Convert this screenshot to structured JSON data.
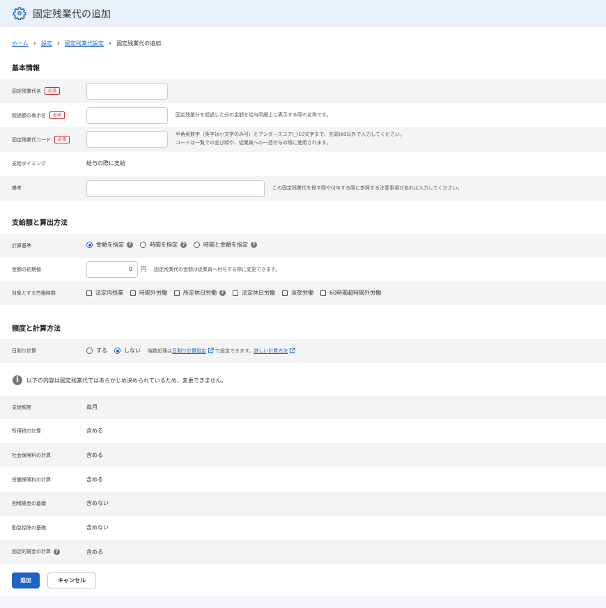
{
  "header": {
    "title": "固定残業代の追加",
    "icon": "gear-icon"
  },
  "breadcrumb": {
    "items": [
      "ホーム",
      "設定",
      "固定残業代設定"
    ],
    "current": "固定残業代の追加"
  },
  "sections": {
    "basic": "基本情報",
    "payment": "支給額と算出方法",
    "frequency": "頻度と計算方法"
  },
  "basic": {
    "name_label": "固定残業代名",
    "required": "必須",
    "display_name_label": "超過額の表示名",
    "display_name_help": "固定残業分を超過した分の金額を給与明細上に表示する際の名称です。",
    "code_label": "固定残業代コード",
    "code_help_1": "半角英数字（英字は小文字のみ可）とアンダースコア(_)10文字まで、先頭は0以外で入力してください。",
    "code_help_2": "コードは一覧での並び順や、従業員への一括付与の際に使用されます。",
    "timing_label": "支給タイミング",
    "timing_value": "給与の際に支給",
    "note_label": "備考",
    "note_help": "この固定残業代を探す際や付与する際に参照する注意事項があれば入力してください。"
  },
  "payment": {
    "basis_label": "計算基準",
    "basis_options": [
      "金額を指定",
      "時間を指定",
      "時間と金額を指定"
    ],
    "basis_selected": "金額を指定",
    "initial_label": "金額の初期値",
    "initial_value": "0",
    "initial_unit": "円",
    "initial_help": "固定残業代の金額は従業員へ付与する際に変更できます。",
    "hours_label": "対象とする労働時間",
    "hours_options": [
      "法定内残業",
      "時間外労働",
      "所定休日労働",
      "法定休日労働",
      "深夜労働",
      "60時間超時間外労働"
    ]
  },
  "frequency": {
    "daily_label": "日割り計算",
    "daily_options": [
      "する",
      "しない"
    ],
    "daily_selected": "しない",
    "daily_help_pre": "端数処理は",
    "daily_help_link": "日割り計算設定",
    "daily_help_mid": "で設定できます。",
    "daily_help_link2": "詳しい計算方法"
  },
  "info": {
    "text": "以下の内容は固定残業代ではあらかじめ決められているため、変更できません。"
  },
  "fixed_rows": [
    {
      "label": "支給頻度",
      "value": "毎月"
    },
    {
      "label": "所得税の計算",
      "value": "含める"
    },
    {
      "label": "社会保険料の計算",
      "value": "含める"
    },
    {
      "label": "労働保険料の計算",
      "value": "含める"
    },
    {
      "label": "割増賃金の基礎",
      "value": "含めない"
    },
    {
      "label": "勤怠控除の基礎",
      "value": "含めない"
    },
    {
      "label": "固定的賃金の計算",
      "value": "含める"
    }
  ],
  "buttons": {
    "add": "追加",
    "cancel": "キャンセル"
  },
  "colors": {
    "accent": "#1e62c5",
    "required": "#c62828",
    "header_bg": "#e9f1fb",
    "row_shade": "#f4f4f4"
  }
}
